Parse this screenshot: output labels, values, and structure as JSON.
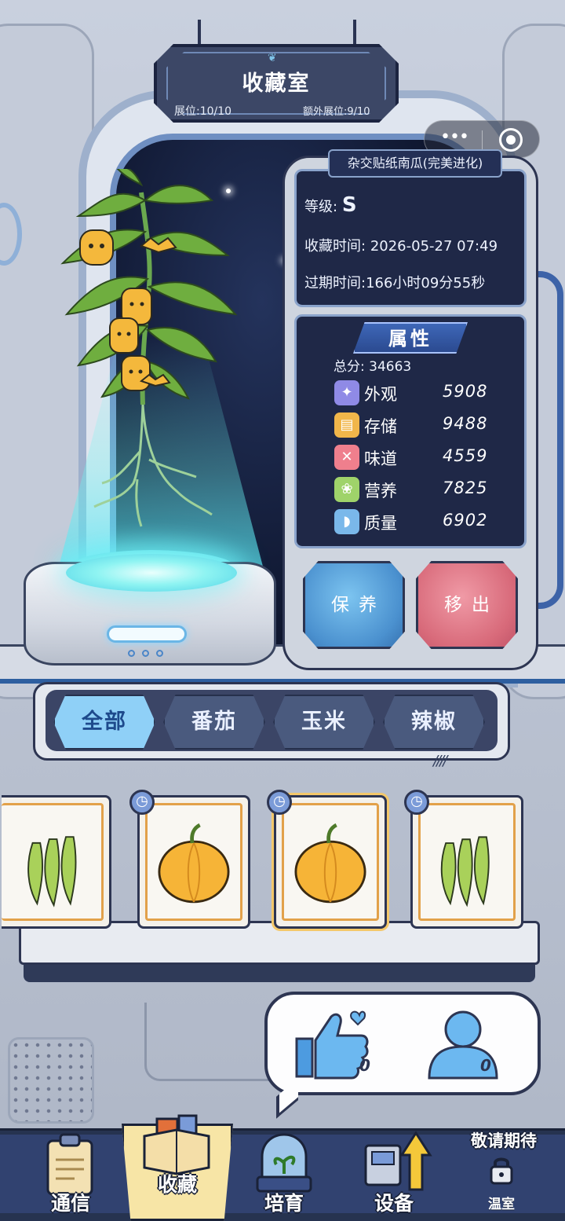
{
  "title": {
    "name": "收藏室",
    "slots": "展位:10/10",
    "extra_slots": "额外展位:9/10"
  },
  "capsule": {
    "more_icon": "more-dots-icon",
    "close_icon": "target-icon"
  },
  "plant_info": {
    "name": "杂交贴纸南瓜(完美进化)",
    "grade_label": "等级:",
    "grade_value": "S",
    "collect_time_label": "收藏时间:",
    "collect_time_value": "2026-05-27 07:49",
    "expire_label": "过期时间:",
    "expire_value": "166小时09分55秒"
  },
  "attributes": {
    "title": "属性",
    "total_label": "总分:",
    "total_value": "34663",
    "items": [
      {
        "label": "外观",
        "value": "5908",
        "icon": "sparkle-icon",
        "color": "#8f8ae6"
      },
      {
        "label": "存储",
        "value": "9488",
        "icon": "storage-icon",
        "color": "#f1b64a"
      },
      {
        "label": "味道",
        "value": "4559",
        "icon": "utensils-icon",
        "color": "#ef7f8d"
      },
      {
        "label": "营养",
        "value": "7825",
        "icon": "nutrition-icon",
        "color": "#9fd36a"
      },
      {
        "label": "质量",
        "value": "6902",
        "icon": "muscle-icon",
        "color": "#7ab8ea"
      }
    ]
  },
  "actions": {
    "maintain": "保养",
    "remove": "移出"
  },
  "tabs": [
    {
      "label": "全部",
      "active": true
    },
    {
      "label": "番茄",
      "active": false
    },
    {
      "label": "玉米",
      "active": false
    },
    {
      "label": "辣椒",
      "active": false
    }
  ],
  "cards": [
    {
      "item": "okra",
      "timer": false,
      "selected": false
    },
    {
      "item": "pumpkin",
      "timer": true,
      "selected": false
    },
    {
      "item": "pumpkin",
      "timer": true,
      "selected": true
    },
    {
      "item": "okra",
      "timer": true,
      "selected": false
    }
  ],
  "social": {
    "likes": "0",
    "visitors": "0"
  },
  "nav": {
    "items": [
      {
        "label": "通信",
        "icon": "clipboard-icon"
      },
      {
        "label": "收藏",
        "icon": "box-icon",
        "active": true
      },
      {
        "label": "培育",
        "icon": "seedling-dome-icon"
      },
      {
        "label": "设备",
        "icon": "machine-upgrade-icon"
      }
    ],
    "coming_soon": "敬请期待",
    "greenhouse": "温室"
  },
  "colors": {
    "accent_blue": "#8fd0f7",
    "panel_dark": "#1f2847",
    "maintain": "#4b91cf",
    "remove": "#d86a7a",
    "hologram": "#6ff0f0"
  }
}
